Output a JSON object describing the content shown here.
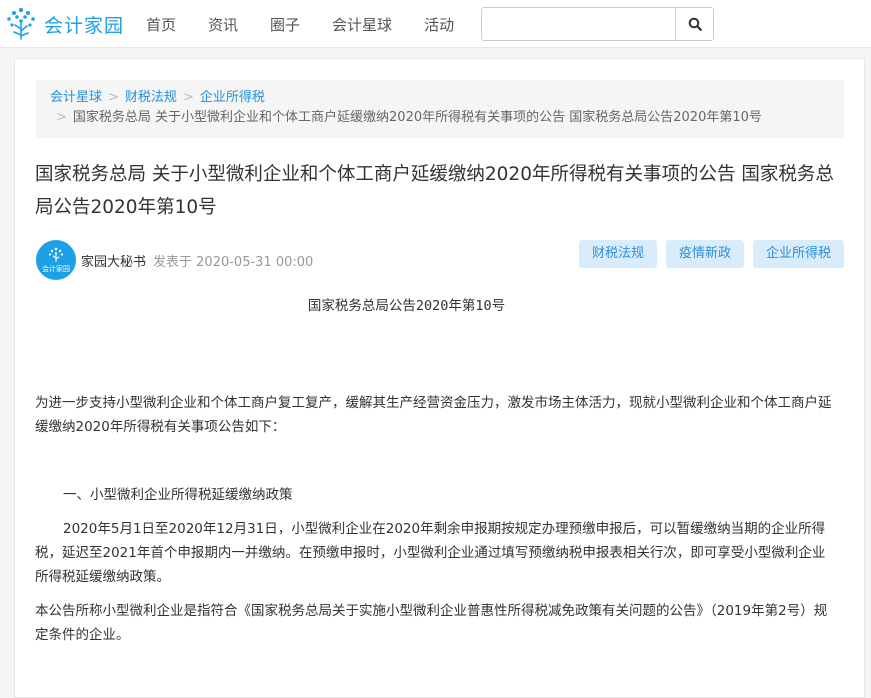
{
  "header": {
    "logo_text": "会计家园",
    "nav": [
      "首页",
      "资讯",
      "圈子",
      "会计星球",
      "活动"
    ],
    "search_placeholder": ""
  },
  "breadcrumb": {
    "items": [
      "会计星球",
      "财税法规",
      "企业所得税"
    ],
    "current": "国家税务总局 关于小型微利企业和个体工商户延缓缴纳2020年所得税有关事项的公告 国家税务总局公告2020年第10号"
  },
  "article": {
    "title": "国家税务总局 关于小型微利企业和个体工商户延缓缴纳2020年所得税有关事项的公告 国家税务总局公告2020年第10号",
    "avatar_text": "会计家园",
    "author": "家园大秘书",
    "posted_prefix": "发表于",
    "posted_time": "2020-05-31 00:00",
    "tags": [
      "财税法规",
      "疫情新政",
      "企业所得税"
    ],
    "subtitle": "国家税务总局公告2020年第10号",
    "paragraphs": [
      "为进一步支持小型微利企业和个体工商户复工复产，缓解其生产经营资金压力，激发市场主体活力，现就小型微利企业和个体工商户延缓缴纳2020年所得税有关事项公告如下：",
      "一、小型微利企业所得税延缓缴纳政策",
      "2020年5月1日至2020年12月31日，小型微利企业在2020年剩余申报期按规定办理预缴申报后，可以暂缓缴纳当期的企业所得税，延迟至2021年首个申报期内一并缴纳。在预缴申报时，小型微利企业通过填写预缴纳税申报表相关行次，即可享受小型微利企业所得税延缓缴纳政策。",
      "本公告所称小型微利企业是指符合《国家税务总局关于实施小型微利企业普惠性所得税减免政策有关问题的公告》（2019年第2号）规定条件的企业。"
    ]
  },
  "colors": {
    "brand": "#1ea0e6",
    "link": "#2a8fd6",
    "tag_bg": "#d9ecfb"
  }
}
